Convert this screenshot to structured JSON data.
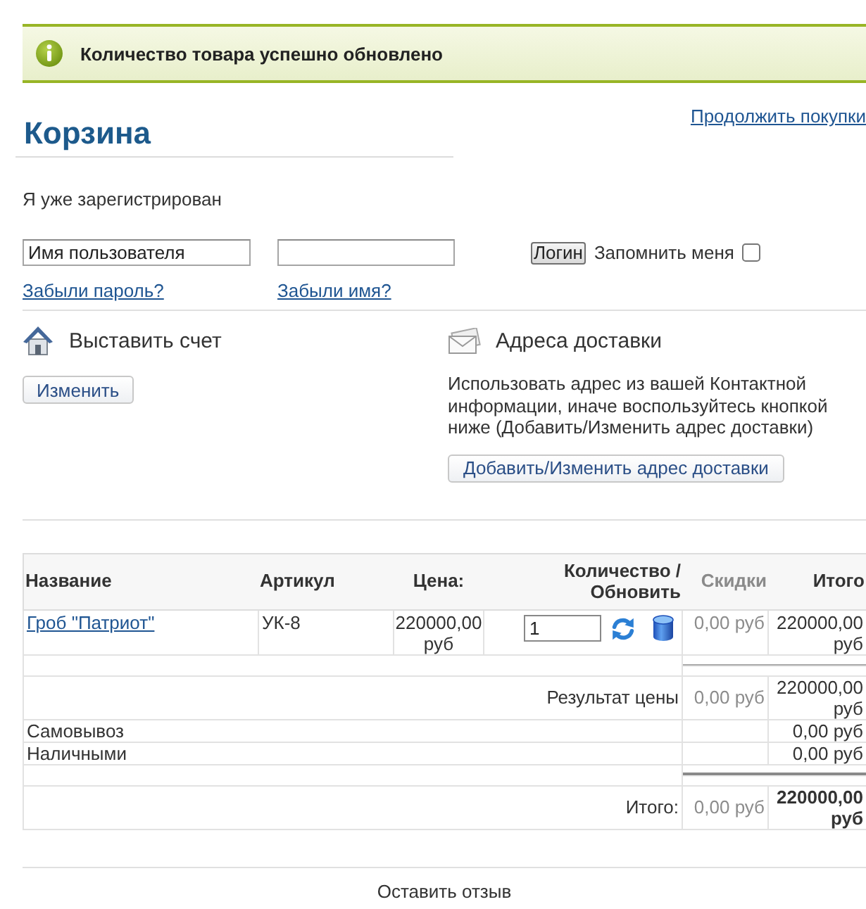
{
  "message": {
    "text": "Количество товара успешно обновлено"
  },
  "continue_link": "Продолжить покупки",
  "title": "Корзина",
  "login": {
    "heading": "Я уже зарегистрирован",
    "username": {
      "value": "Имя пользователя"
    },
    "button": "Логин",
    "remember": {
      "label": "Запомнить меня",
      "checked": false
    },
    "links": [
      "Забыли пароль?",
      "Забыли имя?"
    ]
  },
  "billing": {
    "title": "Выставить счет",
    "button": "Изменить"
  },
  "shipping": {
    "title": "Адреса доставки",
    "text": "Использовать адрес из вашей Контактной информации, иначе воспользуйтесь кнопкой ниже (Добавить/Изменить адрес доставки)",
    "button": "Добавить/Изменить адрес доставки"
  },
  "cart": {
    "columns": [
      "Название",
      "Артикул",
      "Цена:",
      "Количество / Обновить",
      "Скидки",
      "Итого"
    ],
    "items": [
      {
        "name": "Гроб \"Патриот\"",
        "sku": "УК-8",
        "price": "220000,00 руб",
        "quantity": "1",
        "discount": "0,00 руб",
        "total": "220000,00 руб"
      }
    ],
    "subtotal": {
      "label": "Результат цены",
      "discount": "0,00 руб",
      "total": "220000,00 руб"
    },
    "charges": [
      {
        "label": "Самовывоз",
        "amount": "0,00 руб"
      },
      {
        "label": "Наличными",
        "amount": "0,00 руб"
      }
    ],
    "grand_total": {
      "label": "Итого:",
      "discount": "0,00 руб",
      "total": "220000,00 руб"
    }
  },
  "footer_link": "Оставить отзыв"
}
